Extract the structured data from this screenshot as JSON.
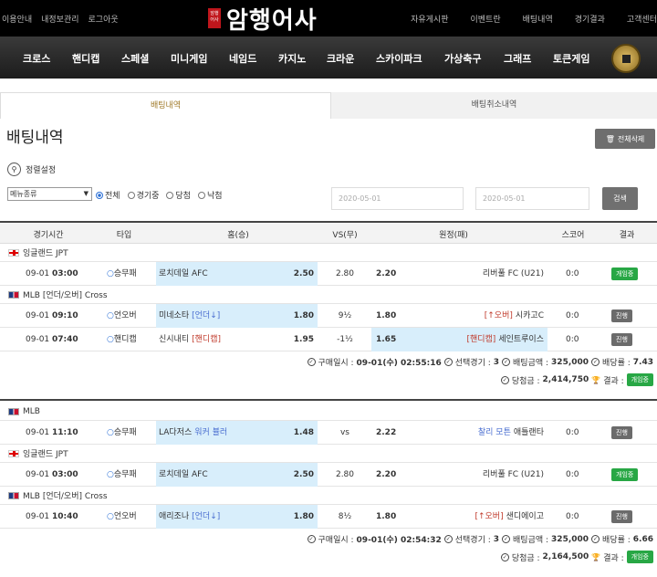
{
  "topbar": {
    "left_links": [
      "이용안내",
      "내정보관리",
      "로그아웃"
    ],
    "right_links": [
      "자유게시판",
      "이벤트란",
      "배팅내역",
      "경기결과",
      "고객센터"
    ],
    "logo_seal": "암행 어사",
    "logo_text": "암행어사"
  },
  "nav": {
    "items": [
      "크로스",
      "핸디캡",
      "스페셜",
      "미니게임",
      "네임드",
      "카지노",
      "크라운",
      "스카이파크",
      "가상축구",
      "그래프",
      "토큰게임"
    ]
  },
  "tabs": {
    "active": "배팅내역",
    "other": "배팅취소내역"
  },
  "page_title": "배팅내역",
  "delete_all_label": "전체삭제",
  "filter": {
    "settings_label": "정렬설정",
    "menu_select": "메뉴종류",
    "radios": [
      {
        "label": "전체",
        "checked": true
      },
      {
        "label": "경기중",
        "checked": false
      },
      {
        "label": "당첨",
        "checked": false
      },
      {
        "label": "낙첨",
        "checked": false
      }
    ],
    "date_from": "2020-05-01",
    "date_to": "2020-05-01",
    "search_label": "검색"
  },
  "table_headers": [
    "경기시간",
    "타입",
    "홈(승)",
    "VS(무)",
    "원정(패)",
    "스코어",
    "결과"
  ],
  "groups": [
    {
      "leagues": [
        {
          "name": "잉글랜드 JPT",
          "flag": "eng",
          "rows": [
            {
              "date": "09-01",
              "time": "03:00",
              "type": "승무패",
              "home": "로치데일 AFC",
              "home_tag": "",
              "home_odd": "2.50",
              "mid": "2.80",
              "away_odd": "2.20",
              "away_tag": "",
              "away": "리버풀 FC (U21)",
              "score": "0:0",
              "result": "개임중",
              "result_color": "#28a745",
              "selected": "home"
            }
          ]
        },
        {
          "name": "MLB [언더/오버] Cross",
          "flag": "mlb",
          "rows": [
            {
              "date": "09-01",
              "time": "09:10",
              "type": "언오버",
              "home": "미네소타",
              "home_tag": "[언더↓]",
              "home_odd": "1.80",
              "mid": "9½",
              "away_odd": "1.80",
              "away_tag": "[↑오버]",
              "away": "시카고C",
              "score": "0:0",
              "result": "진행",
              "result_color": "#6b6b6b",
              "selected": "home"
            },
            {
              "date": "09-01",
              "time": "07:40",
              "type": "핸디캡",
              "home": "신시내티",
              "home_tag": "[핸디캡]",
              "home_odd": "1.95",
              "mid": "-1½",
              "away_odd": "1.65",
              "away_tag": "[핸디캡]",
              "away": "세인트루이스",
              "score": "0:0",
              "result": "진행",
              "result_color": "#6b6b6b",
              "selected": "away"
            }
          ]
        }
      ],
      "summary": {
        "purchase_label": "구매일시 :",
        "purchase": "09-01(수) 02:55:16",
        "games_label": "선택경기 :",
        "games": "3",
        "amount_label": "배팅금액 :",
        "amount": "325,000",
        "rate_label": "배당률 :",
        "rate": "7.43",
        "win_label": "당첨금 :",
        "win": "2,414,750",
        "result_label": "결과 :",
        "result": "개임중"
      }
    },
    {
      "leagues": [
        {
          "name": "MLB",
          "flag": "mlb",
          "rows": [
            {
              "date": "09-01",
              "time": "11:10",
              "type": "승무패",
              "home": "LA다저스",
              "home_tag": "워커 뷸러",
              "home_odd": "1.48",
              "mid": "vs",
              "away_odd": "2.22",
              "away_tag": "찰리 모튼",
              "away": "애틀랜타",
              "score": "0:0",
              "result": "진행",
              "result_color": "#6b6b6b",
              "selected": "home"
            }
          ]
        },
        {
          "name": "잉글랜드 JPT",
          "flag": "eng",
          "rows": [
            {
              "date": "09-01",
              "time": "03:00",
              "type": "승무패",
              "home": "로치데일 AFC",
              "home_tag": "",
              "home_odd": "2.50",
              "mid": "2.80",
              "away_odd": "2.20",
              "away_tag": "",
              "away": "리버풀 FC (U21)",
              "score": "0:0",
              "result": "개임중",
              "result_color": "#28a745",
              "selected": "home"
            }
          ]
        },
        {
          "name": "MLB [언더/오버] Cross",
          "flag": "mlb",
          "rows": [
            {
              "date": "09-01",
              "time": "10:40",
              "type": "언오버",
              "home": "애리조나",
              "home_tag": "[언더↓]",
              "home_odd": "1.80",
              "mid": "8½",
              "away_odd": "1.80",
              "away_tag": "[↑오버]",
              "away": "샌디에이고",
              "score": "0:0",
              "result": "진행",
              "result_color": "#6b6b6b",
              "selected": "home"
            }
          ]
        }
      ],
      "summary": {
        "purchase_label": "구매일시 :",
        "purchase": "09-01(수) 02:54:32",
        "games_label": "선택경기 :",
        "games": "3",
        "amount_label": "배팅금액 :",
        "amount": "325,000",
        "rate_label": "배당률 :",
        "rate": "6.66",
        "win_label": "당첨금 :",
        "win": "2,164,500",
        "result_label": "결과 :",
        "result": "개임중"
      }
    }
  ]
}
